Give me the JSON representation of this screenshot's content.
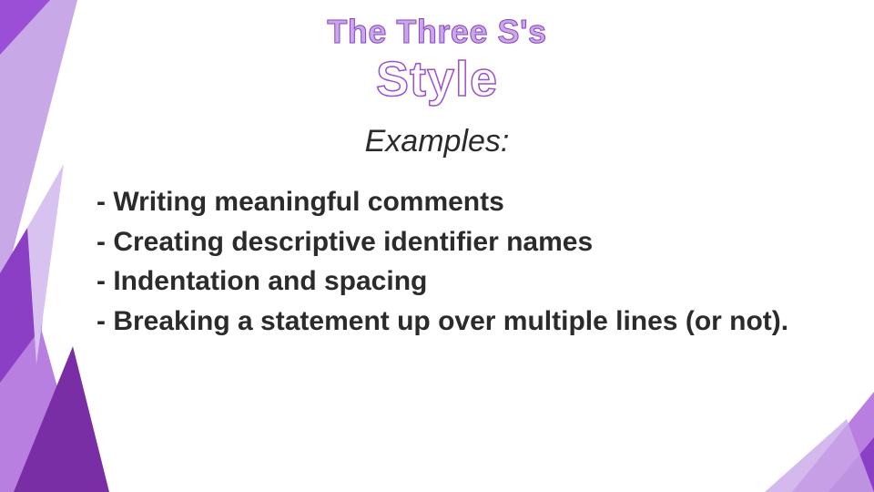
{
  "title": "The Three S's",
  "subtitle": "Style",
  "examples_label": "Examples:",
  "bullets": [
    "- Writing meaningful comments",
    "- Creating descriptive identifier names",
    "- Indentation and spacing",
    "- Breaking a statement up over multiple lines (or not)."
  ],
  "colors": {
    "accent_light": "#c9a8e8",
    "accent_mid": "#a85ed6",
    "accent_dark": "#7a2ea6"
  }
}
